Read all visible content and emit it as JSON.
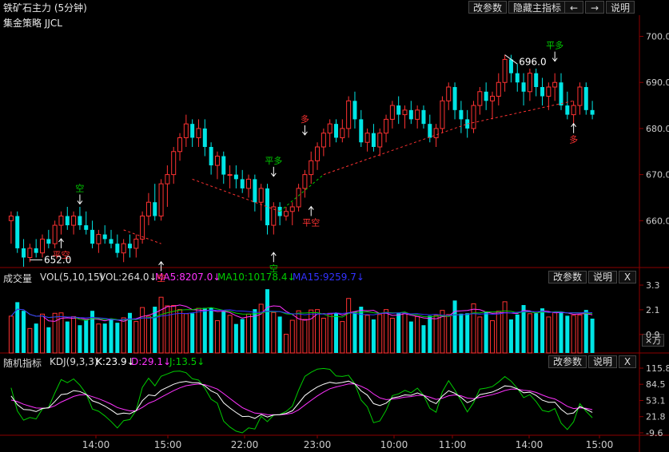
{
  "header": {
    "title": "铁矿石主力 (5分钟)",
    "buttons": [
      "改参数",
      "隐藏主指标",
      "←",
      "→",
      "说明"
    ],
    "strategy": "集金策略  JJCL"
  },
  "colors": {
    "up": "#ff3232",
    "down": "#00e5e5",
    "ma5": "#ff32ff",
    "ma10": "#00cc00",
    "ma15": "#3232ff",
    "k": "#ffffff",
    "d": "#ff32ff",
    "j": "#00cc00",
    "axis": "#8b0000"
  },
  "chart_data": [
    {
      "type": "candlestick",
      "y_ticks": [
        "700.0",
        "690.0",
        "680.0",
        "670.0",
        "660.0"
      ],
      "ylim": [
        650,
        702
      ],
      "x_ticks": [
        "14:00",
        "15:00",
        "22:00",
        "23:00",
        "10:00",
        "11:00",
        "14:00",
        "15:00"
      ],
      "ohlc": [
        [
          660,
          662,
          655,
          661
        ],
        [
          661,
          662,
          653,
          654
        ],
        [
          654,
          656,
          650,
          652
        ],
        [
          652,
          655,
          651,
          654
        ],
        [
          654,
          656,
          652,
          653
        ],
        [
          653,
          657,
          652,
          656
        ],
        [
          656,
          658,
          654,
          655
        ],
        [
          655,
          660,
          654,
          659
        ],
        [
          659,
          662,
          657,
          661
        ],
        [
          661,
          663,
          658,
          659
        ],
        [
          659,
          662,
          657,
          661
        ],
        [
          661,
          663,
          658,
          659
        ],
        [
          659,
          662,
          657,
          658
        ],
        [
          658,
          660,
          654,
          655
        ],
        [
          655,
          658,
          653,
          657
        ],
        [
          657,
          659,
          655,
          656
        ],
        [
          656,
          658,
          654,
          655
        ],
        [
          655,
          657,
          652,
          653
        ],
        [
          653,
          656,
          651,
          655
        ],
        [
          655,
          657,
          652,
          654
        ],
        [
          654,
          657,
          652,
          656
        ],
        [
          656,
          662,
          655,
          661
        ],
        [
          661,
          666,
          659,
          664
        ],
        [
          664,
          668,
          660,
          661
        ],
        [
          661,
          669,
          660,
          668
        ],
        [
          668,
          672,
          663,
          670
        ],
        [
          670,
          676,
          668,
          675
        ],
        [
          675,
          679,
          673,
          678
        ],
        [
          678,
          683,
          676,
          681
        ],
        [
          681,
          682,
          676,
          678
        ],
        [
          678,
          682,
          676,
          680
        ],
        [
          680,
          682,
          674,
          676
        ],
        [
          676,
          677,
          670,
          672
        ],
        [
          672,
          675,
          669,
          674
        ],
        [
          674,
          675,
          668,
          670
        ],
        [
          670,
          672,
          667,
          670
        ],
        [
          670,
          672,
          667,
          669
        ],
        [
          669,
          671,
          666,
          667
        ],
        [
          667,
          670,
          665,
          669
        ],
        [
          669,
          670,
          662,
          664
        ],
        [
          664,
          668,
          660,
          667
        ],
        [
          667,
          668,
          657,
          659
        ],
        [
          659,
          664,
          657,
          663
        ],
        [
          663,
          664,
          659,
          661
        ],
        [
          661,
          663,
          660,
          662
        ],
        [
          662,
          664,
          659,
          663
        ],
        [
          663,
          668,
          662,
          667
        ],
        [
          667,
          671,
          665,
          670
        ],
        [
          670,
          675,
          668,
          673
        ],
        [
          673,
          677,
          671,
          676
        ],
        [
          676,
          680,
          674,
          679
        ],
        [
          679,
          682,
          676,
          681
        ],
        [
          681,
          682,
          677,
          678
        ],
        [
          678,
          682,
          677,
          680
        ],
        [
          680,
          687,
          678,
          686
        ],
        [
          686,
          688,
          680,
          682
        ],
        [
          682,
          684,
          676,
          677
        ],
        [
          677,
          680,
          675,
          679
        ],
        [
          679,
          681,
          675,
          676
        ],
        [
          676,
          680,
          674,
          679
        ],
        [
          679,
          683,
          677,
          682
        ],
        [
          682,
          686,
          680,
          685
        ],
        [
          685,
          687,
          681,
          683
        ],
        [
          683,
          685,
          680,
          684
        ],
        [
          684,
          686,
          681,
          682
        ],
        [
          682,
          685,
          680,
          684
        ],
        [
          684,
          685,
          680,
          681
        ],
        [
          681,
          683,
          677,
          678
        ],
        [
          678,
          681,
          676,
          680
        ],
        [
          680,
          687,
          679,
          686
        ],
        [
          686,
          690,
          684,
          689
        ],
        [
          689,
          690,
          682,
          684
        ],
        [
          684,
          686,
          679,
          682
        ],
        [
          682,
          684,
          678,
          680
        ],
        [
          680,
          686,
          679,
          685
        ],
        [
          685,
          689,
          683,
          688
        ],
        [
          688,
          690,
          684,
          686
        ],
        [
          686,
          688,
          682,
          687
        ],
        [
          687,
          692,
          685,
          690
        ],
        [
          690,
          696,
          688,
          695
        ],
        [
          695,
          696,
          690,
          692
        ],
        [
          692,
          694,
          688,
          690
        ],
        [
          690,
          692,
          685,
          688
        ],
        [
          688,
          693,
          686,
          692
        ],
        [
          692,
          693,
          687,
          689
        ],
        [
          689,
          691,
          685,
          687
        ],
        [
          687,
          690,
          684,
          689
        ],
        [
          689,
          692,
          686,
          690
        ],
        [
          690,
          692,
          684,
          685
        ],
        [
          685,
          688,
          682,
          683
        ],
        [
          683,
          686,
          681,
          685
        ],
        [
          685,
          690,
          683,
          689
        ],
        [
          689,
          690,
          683,
          684
        ],
        [
          684,
          686,
          682,
          683
        ]
      ],
      "annotations": [
        "空",
        "平空",
        "空",
        "平多",
        "空",
        "多",
        "平空",
        "平多",
        "多"
      ],
      "price_labels": [
        "652.0",
        "696.0"
      ]
    },
    {
      "type": "bar",
      "title": "成交量",
      "indicator": "VOL(5,10,15)",
      "values_text": {
        "vol": "VOL:264.0↓",
        "ma5": "MA5:8207.0↓",
        "ma10": "MA10:10178.4↓",
        "ma15": "MA15:9259.7↓"
      },
      "y_ticks": [
        "3.3",
        "2.1",
        "0.9"
      ],
      "unit_button": "×万",
      "ylim": [
        0,
        3.3
      ]
    },
    {
      "type": "line",
      "title": "随机指标",
      "indicator": "KDJ(9,3,3)",
      "values_text": {
        "k": "K:23.9↓",
        "d": "D:29.1↓",
        "j": "J:13.5↓"
      },
      "y_ticks": [
        "115.8",
        "84.5",
        "53.1",
        "21.8",
        "-9.6"
      ],
      "ylim": [
        -9.6,
        115.8
      ]
    }
  ],
  "sub_buttons": {
    "params": "改参数",
    "explain": "说明",
    "close": "X"
  }
}
